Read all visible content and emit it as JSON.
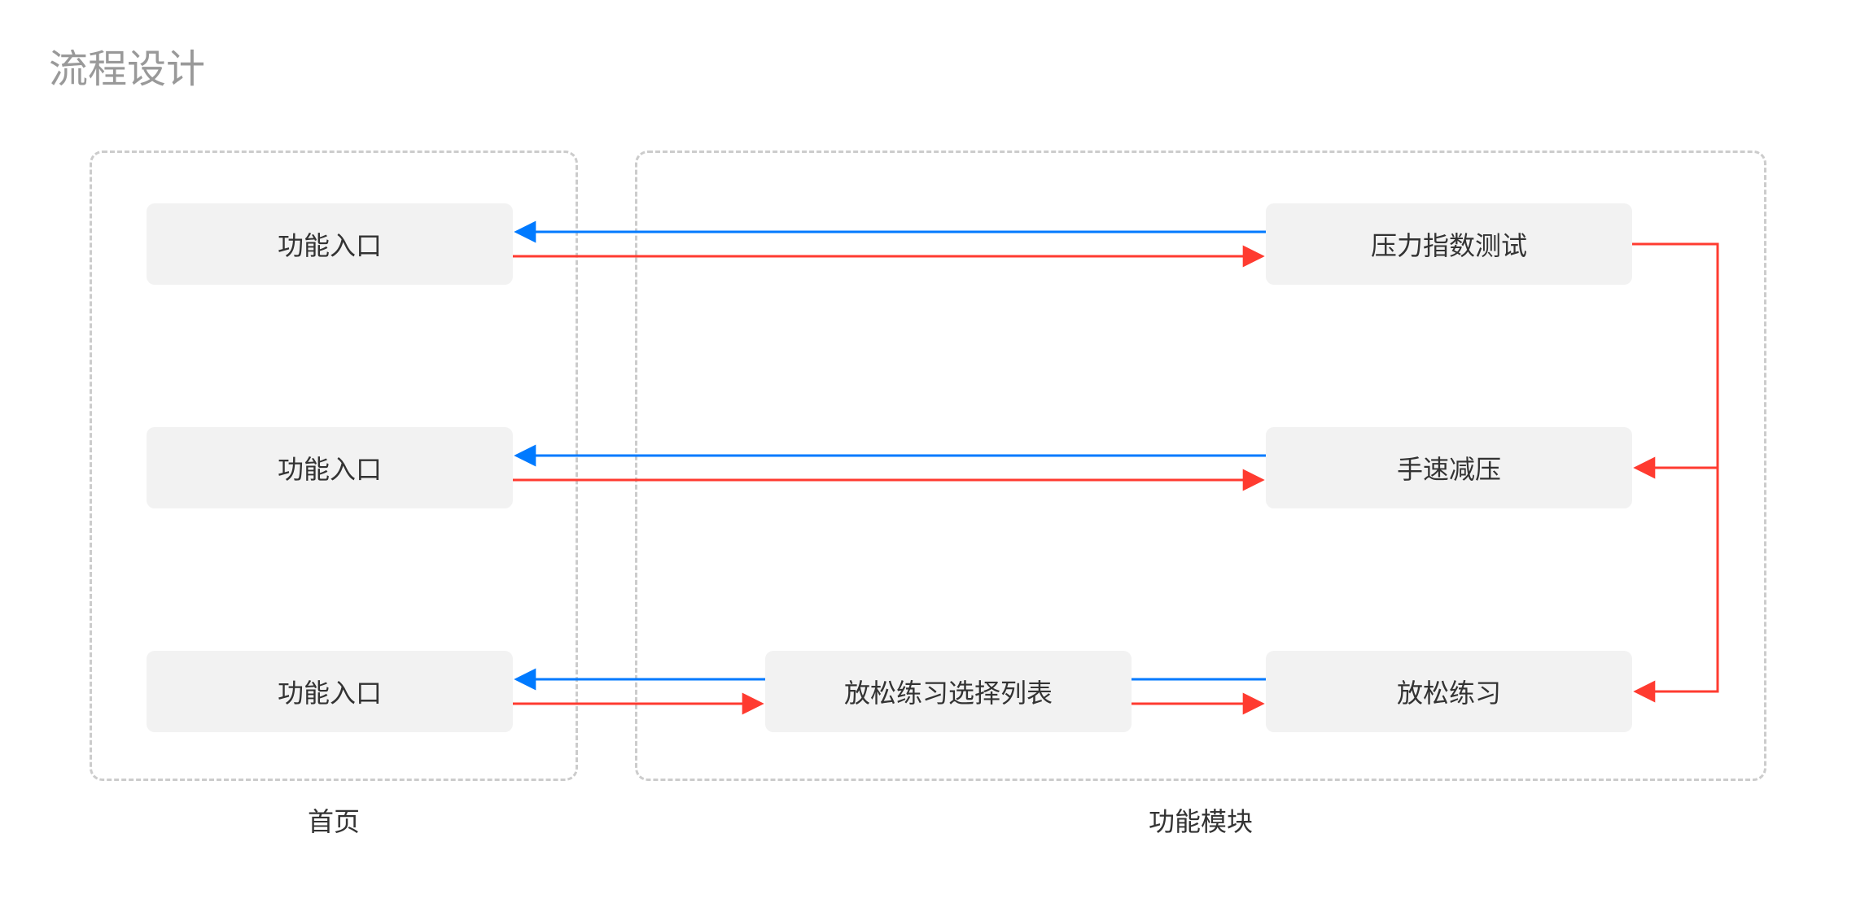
{
  "title": "流程设计",
  "groups": {
    "home": {
      "label": "首页"
    },
    "modules": {
      "label": "功能模块"
    }
  },
  "nodes": {
    "entry1": "功能入口",
    "entry2": "功能入口",
    "entry3": "功能入口",
    "stress": "压力指数测试",
    "hand": "手速减压",
    "relaxList": "放松练习选择列表",
    "relax": "放松练习"
  },
  "colors": {
    "red": "#ff3b30",
    "blue": "#007aff",
    "border": "#cccccc",
    "nodeBg": "#f2f2f2",
    "titleText": "#999999",
    "labelText": "#333333"
  },
  "chart_data": {
    "type": "flowchart",
    "title": "流程设计",
    "groups": [
      {
        "id": "home",
        "label": "首页"
      },
      {
        "id": "modules",
        "label": "功能模块"
      }
    ],
    "nodes": [
      {
        "id": "entry1",
        "label": "功能入口",
        "group": "home"
      },
      {
        "id": "entry2",
        "label": "功能入口",
        "group": "home"
      },
      {
        "id": "entry3",
        "label": "功能入口",
        "group": "home"
      },
      {
        "id": "stress",
        "label": "压力指数测试",
        "group": "modules"
      },
      {
        "id": "hand",
        "label": "手速减压",
        "group": "modules"
      },
      {
        "id": "relaxList",
        "label": "放松练习选择列表",
        "group": "modules"
      },
      {
        "id": "relax",
        "label": "放松练习",
        "group": "modules"
      }
    ],
    "edges": [
      {
        "from": "entry1",
        "to": "stress",
        "color": "red"
      },
      {
        "from": "stress",
        "to": "entry1",
        "color": "blue"
      },
      {
        "from": "entry2",
        "to": "hand",
        "color": "red"
      },
      {
        "from": "hand",
        "to": "entry2",
        "color": "blue"
      },
      {
        "from": "entry3",
        "to": "relaxList",
        "color": "red"
      },
      {
        "from": "relaxList",
        "to": "relax",
        "color": "red"
      },
      {
        "from": "relax",
        "to": "entry3",
        "color": "blue"
      },
      {
        "from": "stress",
        "to": "hand",
        "color": "red"
      },
      {
        "from": "stress",
        "to": "relax",
        "color": "red"
      }
    ]
  }
}
